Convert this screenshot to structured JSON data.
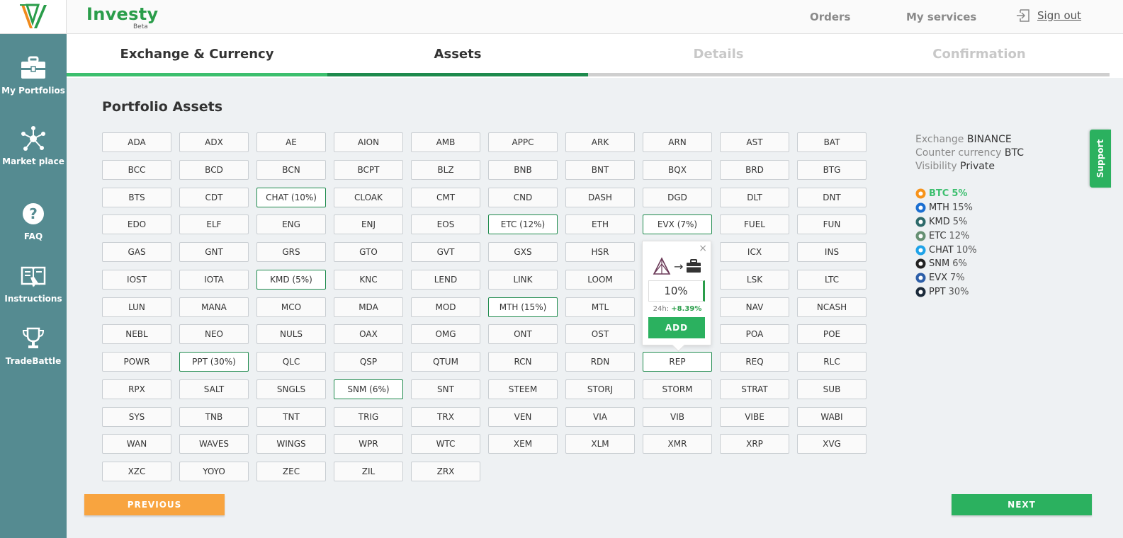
{
  "app": {
    "brand": "Investy",
    "badge": "Beta",
    "logo_icon": "investy-v-logo-icon"
  },
  "topnav": {
    "orders": "Orders",
    "services": "My services",
    "signout": "Sign out"
  },
  "sidebar": {
    "items": [
      {
        "label": "My Portfolios",
        "icon": "briefcase-icon"
      },
      {
        "label": "Market place",
        "icon": "network-icon"
      },
      {
        "label": "FAQ",
        "icon": "question-icon"
      },
      {
        "label": "Instructions",
        "icon": "book-icon"
      },
      {
        "label": "TradeBattle",
        "icon": "trophy-icon"
      }
    ]
  },
  "steps": [
    {
      "label": "Exchange & Currency",
      "state": "done"
    },
    {
      "label": "Assets",
      "state": "active"
    },
    {
      "label": "Details",
      "state": "pending"
    },
    {
      "label": "Confirmation",
      "state": "pending"
    }
  ],
  "main": {
    "title": "Portfolio Assets"
  },
  "assets": [
    "ADA",
    "ADX",
    "AE",
    "AION",
    "AMB",
    "APPC",
    "ARK",
    "ARN",
    "AST",
    "BAT",
    "BCC",
    "BCD",
    "BCN",
    "BCPT",
    "BLZ",
    "BNB",
    "BNT",
    "BQX",
    "BRD",
    "BTG",
    "BTS",
    "CDT",
    "CHAT (10%)",
    "CLOAK",
    "CMT",
    "CND",
    "DASH",
    "DGD",
    "DLT",
    "DNT",
    "EDO",
    "ELF",
    "ENG",
    "ENJ",
    "EOS",
    "ETC (12%)",
    "ETH",
    "EVX (7%)",
    "FUEL",
    "FUN",
    "GAS",
    "GNT",
    "GRS",
    "GTO",
    "GVT",
    "GXS",
    "HSR",
    "",
    "ICX",
    "INS",
    "IOST",
    "IOTA",
    "KMD (5%)",
    "KNC",
    "LEND",
    "LINK",
    "LOOM",
    "",
    "LSK",
    "LTC",
    "LUN",
    "MANA",
    "MCO",
    "MDA",
    "MOD",
    "MTH (15%)",
    "MTL",
    "",
    "NAV",
    "NCASH",
    "NEBL",
    "NEO",
    "NULS",
    "OAX",
    "OMG",
    "ONT",
    "OST",
    "",
    "POA",
    "POE",
    "POWR",
    "PPT (30%)",
    "QLC",
    "QSP",
    "QTUM",
    "RCN",
    "RDN",
    "REP",
    "REQ",
    "RLC",
    "RPX",
    "SALT",
    "SNGLS",
    "SNM (6%)",
    "SNT",
    "STEEM",
    "STORJ",
    "STORM",
    "STRAT",
    "SUB",
    "SYS",
    "TNB",
    "TNT",
    "TRIG",
    "TRX",
    "VEN",
    "VIA",
    "VIB",
    "VIBE",
    "WABI",
    "WAN",
    "WAVES",
    "WINGS",
    "WPR",
    "WTC",
    "XEM",
    "XLM",
    "XMR",
    "XRP",
    "XVG",
    "XZC",
    "YOYO",
    "ZEC",
    "ZIL",
    "ZRX"
  ],
  "selected_assets": [
    "CHAT (10%)",
    "ETC (12%)",
    "EVX (7%)",
    "KMD (5%)",
    "MTH (15%)",
    "PPT (30%)",
    "SNM (6%)",
    "REP"
  ],
  "popup": {
    "close": "×",
    "arrow": "→",
    "from_icon": "rep-triangle-icon",
    "to_icon": "briefcase-icon",
    "percent_value": "10%",
    "change_label": "24h:",
    "change_value": "+8.39%",
    "add_label": "ADD"
  },
  "info": {
    "exchange_label": "Exchange",
    "exchange_value": "BINANCE",
    "currency_label": "Counter currency",
    "currency_value": "BTC",
    "visibility_label": "Visibility",
    "visibility_value": "Private"
  },
  "allocations": [
    {
      "symbol": "BTC",
      "pct": "5%",
      "icon": "btc-icon",
      "color": "#f7931a"
    },
    {
      "symbol": "MTH",
      "pct": "15%",
      "icon": "mth-icon",
      "color": "#1b6fd1"
    },
    {
      "symbol": "KMD",
      "pct": "5%",
      "icon": "kmd-icon",
      "color": "#2d6a6a"
    },
    {
      "symbol": "ETC",
      "pct": "12%",
      "icon": "etc-icon",
      "color": "#669073"
    },
    {
      "symbol": "CHAT",
      "pct": "10%",
      "icon": "chat-icon",
      "color": "#1fa3e8"
    },
    {
      "symbol": "SNM",
      "pct": "6%",
      "icon": "snm-icon",
      "color": "#222222"
    },
    {
      "symbol": "EVX",
      "pct": "7%",
      "icon": "evx-icon",
      "color": "#2c5ea8"
    },
    {
      "symbol": "PPT",
      "pct": "30%",
      "icon": "ppt-icon",
      "color": "#1b2a3a"
    }
  ],
  "support": "Support",
  "buttons": {
    "previous": "PREVIOUS",
    "next": "NEXT"
  },
  "colors": {
    "accent_green": "#2bb15f",
    "sidebar_teal": "#558b91",
    "prev_orange": "#f8a43f",
    "step_done": "#3cbf6e",
    "step_active": "#1e8a4d",
    "step_pending": "#cfcfcf"
  }
}
